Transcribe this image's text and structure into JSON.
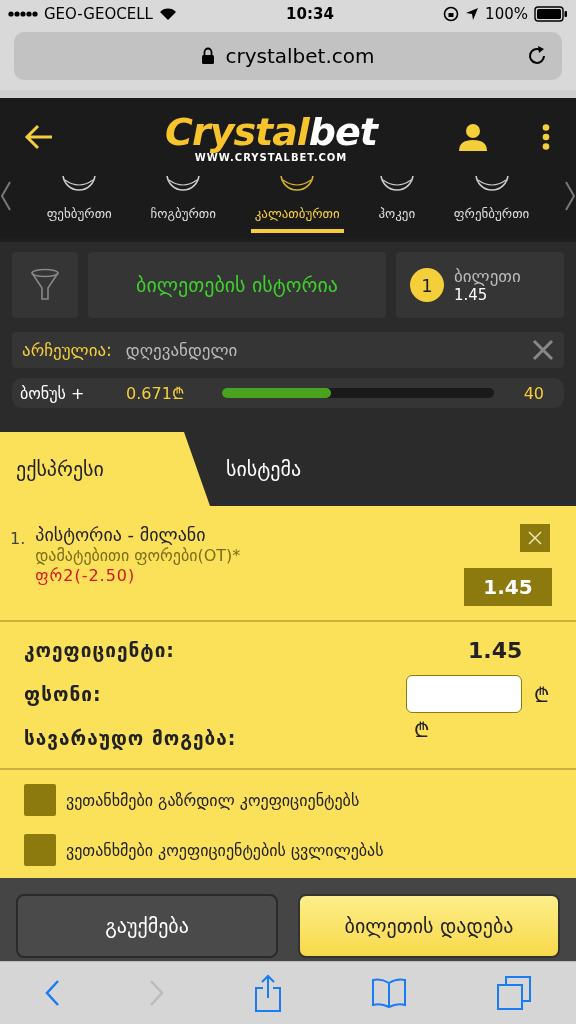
{
  "status_bar": {
    "carrier": "GEO-GEOCELL",
    "time": "10:34",
    "battery": "100%"
  },
  "browser": {
    "url": "crystalbet.com"
  },
  "header": {
    "logo_main": "Crystal",
    "logo_accent": "bet",
    "logo_url": "WWW.CRYSTALBET.COM"
  },
  "sports": [
    {
      "label": "ფეხბურთი",
      "selected": false
    },
    {
      "label": "ჩოგბურთი",
      "selected": false
    },
    {
      "label": "კალათბურთი",
      "selected": true
    },
    {
      "label": "ჰოკეი",
      "selected": false
    },
    {
      "label": "ფრენბურთი",
      "selected": false
    }
  ],
  "history_button": "ბილეთების ისტორია",
  "ticket": {
    "count": "1",
    "label": "ბილეთი",
    "odds": "1.45"
  },
  "filter": {
    "label": "არჩეულია:",
    "value": "დღევანდელი"
  },
  "bonus": {
    "label": "ბონუს +",
    "amount": "0.671₾",
    "level": 0.4,
    "target": "40"
  },
  "slip_tabs": [
    {
      "label": "ექსპრესი",
      "selected": true
    },
    {
      "label": "სისტემა",
      "selected": false
    }
  ],
  "bet": {
    "number": "1.",
    "match": "პისტორია - მილანი",
    "market": "დამატებითი ფორები(OT)*",
    "selection": "ფრ2(-2.50)",
    "odds": "1.45"
  },
  "summary": [
    {
      "kind": "value",
      "label": "კოეფიციენტი:",
      "value": "1.45"
    },
    {
      "kind": "input",
      "label": "ფსონი:",
      "currency": "₾"
    },
    {
      "kind": "currency",
      "label": "სავარაუდო მოგება:",
      "currency": "₾"
    }
  ],
  "agreements": [
    {
      "label": "ვეთანხმები გაზრდილ კოეფიციენტებს",
      "checked": false
    },
    {
      "label": "ვეთანხმები კოეფიციენტების ცვლილებას",
      "checked": false
    }
  ],
  "actions": {
    "cancel": "გაუქმება",
    "place": "ბილეთის დადება"
  }
}
